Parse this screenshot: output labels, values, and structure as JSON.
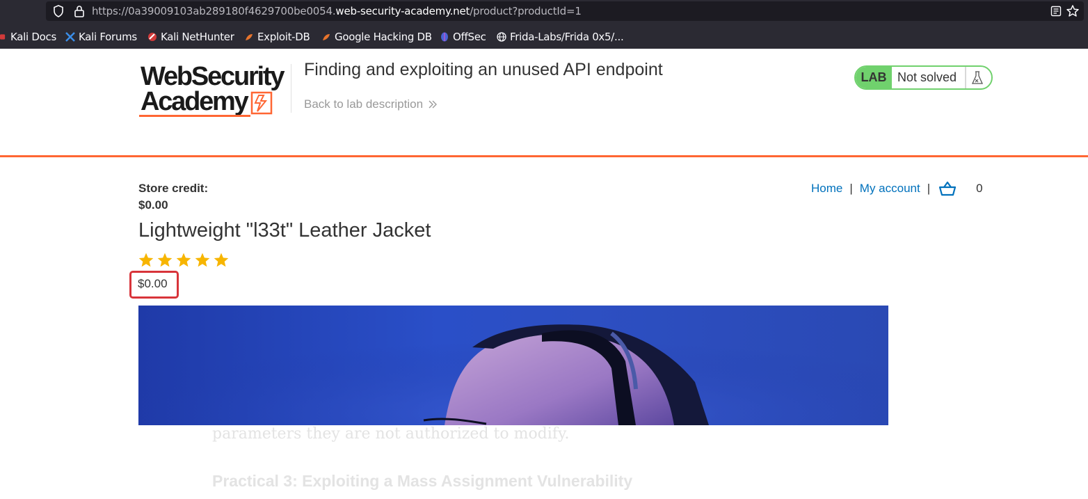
{
  "browser": {
    "url_prefix": "https://0a39009103ab289180f4629700be0054.",
    "url_host": "web-security-academy.net",
    "url_path": "/product?productId=1",
    "bookmarks": [
      {
        "label": "Kali Docs",
        "icon": "kali-docs-icon"
      },
      {
        "label": "Kali Forums",
        "icon": "kali-forums-icon"
      },
      {
        "label": "Kali NetHunter",
        "icon": "kali-nethunter-icon"
      },
      {
        "label": "Exploit-DB",
        "icon": "exploit-db-icon"
      },
      {
        "label": "Google Hacking DB",
        "icon": "google-hacking-db-icon"
      },
      {
        "label": "OffSec",
        "icon": "offsec-icon"
      },
      {
        "label": "Frida-Labs/Frida 0x5/...",
        "icon": "globe-icon"
      }
    ]
  },
  "lab": {
    "logo_line1": "WebSecurity",
    "logo_line2": "Academy",
    "title": "Finding and exploiting an unused API endpoint",
    "back_link": "Back to lab description",
    "badge": "LAB",
    "status": "Not solved",
    "accent_color": "#ff6633",
    "status_color": "#70d16d"
  },
  "store": {
    "credit_label": "Store credit:",
    "credit_value": "$0.00",
    "nav": {
      "home": "Home",
      "separator": "|",
      "my_account": "My account",
      "cart_count": "0"
    }
  },
  "product": {
    "title": "Lightweight \"l33t\" Leather Jacket",
    "rating": 5,
    "rating_max": 5,
    "price": "$0.00"
  },
  "overlay": {
    "text1": "parameters they are not authorized to modify.",
    "text2": "Practical 3: Exploiting a Mass Assignment Vulnerability"
  }
}
